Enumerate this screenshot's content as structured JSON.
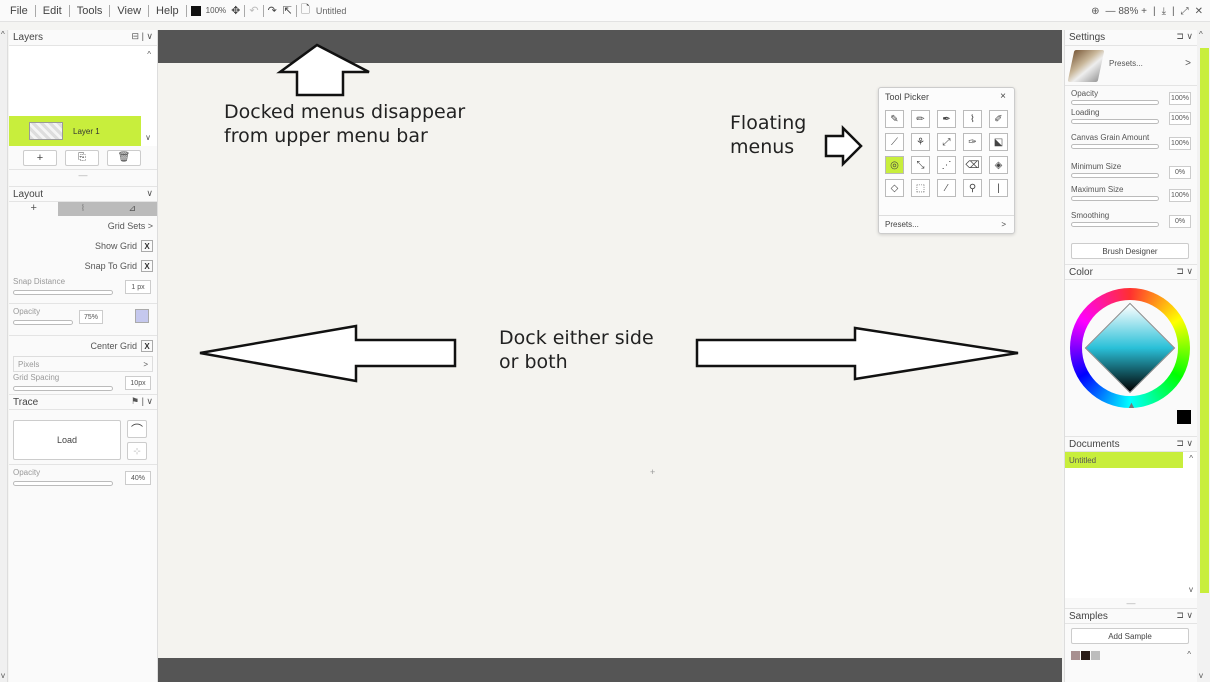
{
  "menu": {
    "items": [
      "File",
      "Edit",
      "Tools",
      "View",
      "Help"
    ],
    "zoom": "100%",
    "doc_title": "Untitled",
    "right_zoom": "— 88% +"
  },
  "layers": {
    "title": "Layers",
    "layer_name": "Layer 1"
  },
  "layout": {
    "title": "Layout",
    "grid_sets": "Grid Sets >",
    "show_grid": "Show Grid",
    "snap_to_grid": "Snap To Grid",
    "snap_distance": "Snap Distance",
    "snap_value": "1 px",
    "opacity": "Opacity",
    "opacity_value": "75%",
    "center_grid": "Center Grid",
    "pixels": "Pixels",
    "grid_spacing": "Grid Spacing",
    "grid_spacing_value": "10px",
    "x_mark": "X"
  },
  "trace": {
    "title": "Trace",
    "load": "Load",
    "opacity": "Opacity",
    "opacity_value": "40%"
  },
  "annotations": {
    "docked": [
      "Docked menus disappear",
      "from upper menu bar"
    ],
    "floating": [
      "Floating",
      "menus"
    ],
    "dock": [
      "Dock either side",
      "or both"
    ]
  },
  "tool_picker": {
    "title": "Tool Picker",
    "presets": "Presets...",
    "presets_arrow": ">"
  },
  "settings": {
    "title": "Settings",
    "presets": "Presets...",
    "presets_arrow": ">",
    "opacity": "Opacity",
    "opacity_value": "100%",
    "opacity_fill": 0.9,
    "loading": "Loading",
    "loading_value": "100%",
    "loading_fill": 0.85,
    "canvas_grain": "Canvas Grain Amount",
    "canvas_grain_value": "100%",
    "canvas_grain_fill": 0.9,
    "min_size": "Minimum Size",
    "min_size_value": "0%",
    "min_size_fill": 0.05,
    "max_size": "Maximum Size",
    "max_size_value": "100%",
    "max_size_fill": 0.9,
    "smoothing": "Smoothing",
    "smoothing_value": "0%",
    "smoothing_fill": 0.05,
    "brush_designer": "Brush Designer"
  },
  "color": {
    "title": "Color"
  },
  "documents": {
    "title": "Documents",
    "item": "Untitled"
  },
  "samples": {
    "title": "Samples",
    "add": "Add Sample"
  },
  "colors": {
    "accent": "#c8ee3c",
    "canvas": "#f4f3ef",
    "dark_bar": "#555555"
  }
}
